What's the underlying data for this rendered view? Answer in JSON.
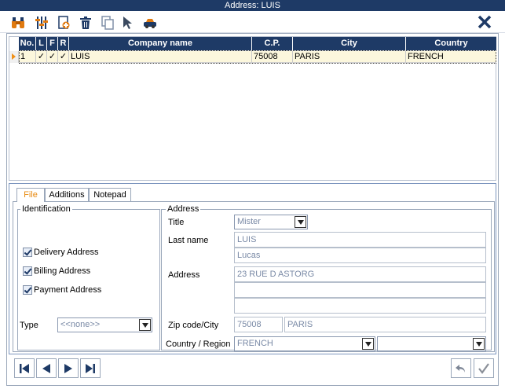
{
  "window": {
    "title": "Address: LUIS"
  },
  "toolbar": {
    "buttons": [
      {
        "icon": "binoculars-icon"
      },
      {
        "icon": "sliders-icon"
      },
      {
        "icon": "add-document-icon"
      },
      {
        "icon": "trash-icon"
      },
      {
        "icon": "copy-icon"
      },
      {
        "icon": "pointer-icon"
      },
      {
        "icon": "car-icon"
      }
    ],
    "close_icon": "close-icon"
  },
  "grid": {
    "columns": [
      "No.",
      "L",
      "F",
      "R",
      "Company name",
      "C.P.",
      "City",
      "Country"
    ],
    "rows": [
      {
        "no": "1",
        "l": "✓",
        "f": "✓",
        "r": "✓",
        "company": "LUIS",
        "cp": "75008",
        "city": "PARIS",
        "country": "FRENCH"
      }
    ]
  },
  "tabs": [
    {
      "label": "File",
      "active": true
    },
    {
      "label": "Additions",
      "active": false
    },
    {
      "label": "Notepad",
      "active": false
    }
  ],
  "identification": {
    "title": "Identification",
    "delivery": {
      "label": "Delivery Address",
      "checked": true
    },
    "billing": {
      "label": "Billing Address",
      "checked": true
    },
    "payment": {
      "label": "Payment Address",
      "checked": true
    },
    "type_label": "Type",
    "type_value": "<<none>>"
  },
  "address": {
    "title": "Address",
    "title_label": "Title",
    "title_value": "Mister",
    "lastname_label": "Last name",
    "lastname_value": "LUIS",
    "firstname_value": "Lucas",
    "address_label": "Address",
    "address_line1": "23 RUE D ASTORG",
    "address_line2": "",
    "address_line3": "",
    "zip_label": "Zip code/City",
    "zip_value": "75008",
    "city_value": "PARIS",
    "country_label": "Country / Region",
    "country_value": "FRENCH",
    "region_value": ""
  },
  "colors": {
    "header": "#1e3a66",
    "accent": "#e88a10",
    "selected_row": "#fcf7dd"
  }
}
